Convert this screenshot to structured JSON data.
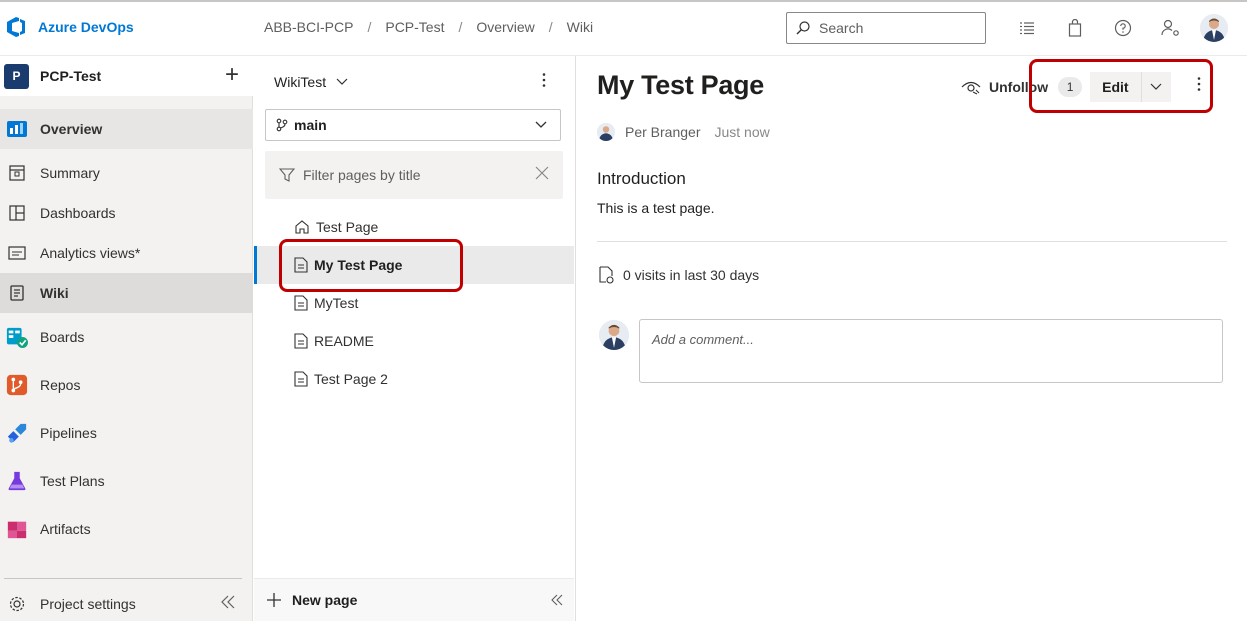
{
  "app": {
    "name": "Azure DevOps"
  },
  "breadcrumb": [
    "ABB-BCI-PCP",
    "PCP-Test",
    "Overview",
    "Wiki"
  ],
  "search": {
    "placeholder": "Search"
  },
  "top_icons": [
    "list-settings-icon",
    "marketplace-bag-icon",
    "help-icon",
    "user-settings-icon",
    "avatar"
  ],
  "project": {
    "initial": "P",
    "name": "PCP-Test",
    "add_label": "+"
  },
  "nav": {
    "items": [
      {
        "label": "Overview",
        "icon": "overview-icon"
      },
      {
        "label": "Summary",
        "icon": "summary-icon"
      },
      {
        "label": "Dashboards",
        "icon": "dashboards-icon"
      },
      {
        "label": "Analytics views*",
        "icon": "analytics-icon"
      },
      {
        "label": "Wiki",
        "icon": "wiki-icon"
      },
      {
        "label": "Boards",
        "icon": "boards-icon"
      },
      {
        "label": "Repos",
        "icon": "repos-icon"
      },
      {
        "label": "Pipelines",
        "icon": "pipelines-icon"
      },
      {
        "label": "Test Plans",
        "icon": "test-plans-icon"
      },
      {
        "label": "Artifacts",
        "icon": "artifacts-icon"
      }
    ],
    "settings_label": "Project settings"
  },
  "wiki": {
    "name": "WikiTest",
    "branch": "main",
    "filter_placeholder": "Filter pages by title",
    "pages": [
      {
        "label": "Test Page",
        "icon": "home-icon"
      },
      {
        "label": "My Test Page",
        "icon": "page-icon",
        "selected": true
      },
      {
        "label": "MyTest",
        "icon": "page-icon"
      },
      {
        "label": "README",
        "icon": "page-icon"
      },
      {
        "label": "Test Page 2",
        "icon": "page-icon"
      }
    ],
    "new_page_label": "New page"
  },
  "page": {
    "title": "My Test Page",
    "unfollow_label": "Unfollow",
    "follower_count": "1",
    "edit_label": "Edit",
    "author": "Per Branger",
    "timestamp": "Just now",
    "heading": "Introduction",
    "body": "This is a test page.",
    "visits": "0 visits in last 30 days",
    "comment_placeholder": "Add a comment..."
  },
  "colors": {
    "accent": "#0078d4",
    "highlight": "#c00000",
    "nav_bg": "#f3f2f1"
  }
}
